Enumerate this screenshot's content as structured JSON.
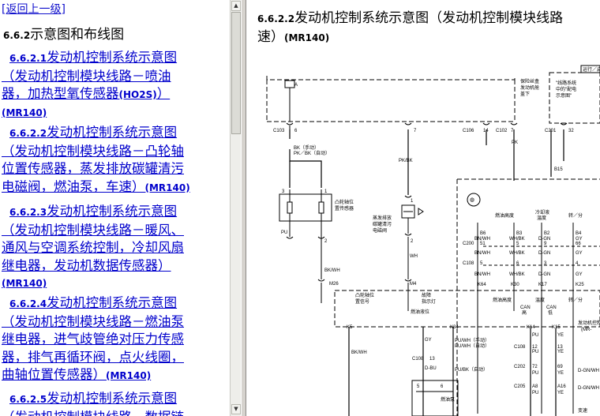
{
  "nav": {
    "back_link": "[返回上一级]",
    "section_num": "6.6.2",
    "section_title": "示意图和布线图"
  },
  "toc": [
    {
      "num": "6.6.2.1",
      "lines": [
        "发动机控制系统示意图",
        "（发动机控制模块线路－喷油",
        "器，加热型氧传感器"
      ],
      "code": "(HO2S)",
      "tail": "）",
      "model": "(MR140)"
    },
    {
      "num": "6.6.2.2",
      "lines": [
        "发动机控制系统示意图",
        "（发动机控制模块线路－凸轮轴",
        "位置传感器，蒸发排放碳罐清污",
        "电磁阀，燃油泵，车速）"
      ],
      "model": "(MR140)"
    },
    {
      "num": "6.6.2.3",
      "lines": [
        "发动机控制系统示意图",
        "（发动机控制模块线路－暖风、",
        "通风与空调系统控制，冷却风扇",
        "继电器，发动机数据传感器）"
      ],
      "model": "(MR140)"
    },
    {
      "num": "6.6.2.4",
      "lines": [
        "发动机控制系统示意图",
        "（发动机控制模块线路－燃油泵",
        "继电器，进气歧管绝对压力传感",
        "器，排气再循环阀，点火线圈，",
        "曲轴位置传感器）"
      ],
      "model": "(MR140)"
    },
    {
      "num": "6.6.2.5",
      "lines": [
        "发动机控制系统示意图",
        "（发动机控制模块线路－数据链"
      ]
    }
  ],
  "scrollbar": {
    "up_arrow": "▲",
    "down_arrow": "▼"
  },
  "content": {
    "title_num": "6.6.2.2",
    "title_line1": "发动机控制系统示意图（发动机控制模块线路",
    "title_line2": "速）",
    "title_model": "(MR140)"
  },
  "diagram": {
    "fuse_labels": [
      "保险丝盒",
      "发动机舱",
      "盖下"
    ],
    "power_labels": [
      "\"线路系统",
      "中的\"配电",
      "示意图\""
    ],
    "run_label": "运行／启",
    "connectors": {
      "c103": "C103",
      "c103_pin": "6",
      "pin7": "7",
      "c106": "C106",
      "c106_pin": "14",
      "c102": "C102",
      "c102_pin": "7",
      "c201": "C201",
      "c201_pin": "32",
      "c200": "C200",
      "c108": "C108",
      "c202": "C202",
      "c205": "C205",
      "m26": "M26",
      "m4": "M4",
      "k5": "K5",
      "k34": "K34",
      "k14": "K14",
      "k15": "K15",
      "b15": "B15"
    },
    "wires": {
      "bk_manual": "BK（手动）",
      "pk_bk_auto": "PK／BK（自动）",
      "pk_bk": "PK/BK",
      "pk": "PK",
      "pu": "PU",
      "bk_wh": "BK/WH",
      "wh": "WH",
      "gy": "GY",
      "pu_wh_manual": "PU/WH（手动）",
      "pu_wh_auto": "PU/WH（自动）",
      "d_bu": "D-BU",
      "pu_bk_auto": "PU/BK（自动）",
      "bk_wh2": "BK/WH"
    },
    "cam_sensor": [
      "凸轮轴位",
      "置传感器"
    ],
    "evap": [
      "蒸发排放",
      "碳罐清污",
      "电磁阀"
    ],
    "cam_signal": [
      "凸轮轴位",
      "置信号"
    ],
    "fault_lamp": [
      "故障",
      "指示灯"
    ],
    "fuel_level": "燃油液位",
    "fuel_pump_assy": "燃油泵",
    "ecm": [
      "发动机控制",
      "(MR-"
    ],
    "trans": "变速",
    "col_headers": [
      "燃油高度",
      "燃油高度",
      "冷却液",
      "转／分"
    ],
    "col_headers2": [
      "温度"
    ],
    "pin_ids": [
      "B6",
      "B3",
      "B2",
      "B4"
    ],
    "wire_top": [
      "BN/WH",
      "WH/BK",
      "D-GN",
      "GY"
    ],
    "pin_nums": [
      "51",
      "5",
      "9",
      "66"
    ],
    "c108_pins": [
      "5",
      "6",
      "3",
      "4"
    ],
    "wire_bot": [
      "BN/WH",
      "WH/BK",
      "D-GN",
      "GY"
    ],
    "k_pins": [
      "K64",
      "K30",
      "K17",
      "K25"
    ],
    "bottom_labels": [
      "燃油高度",
      "温度",
      "转／分"
    ],
    "can_labels": [
      "CAN",
      "高",
      "CAN",
      "低"
    ],
    "k14_wires": [
      "PU",
      "YE",
      "PU",
      "YE"
    ],
    "c108_nums": [
      "12",
      "13"
    ],
    "c202_nums": [
      "72",
      "69"
    ],
    "c205_nums": [
      "A8",
      "A16"
    ],
    "bottom_wires": [
      "PU",
      "YE"
    ],
    "dgn_wh": "D-GN/WH",
    "num_5": "5",
    "num_6": "6",
    "num_1": "1",
    "num_2": "2",
    "num_3": "3",
    "pin_13": "13"
  }
}
